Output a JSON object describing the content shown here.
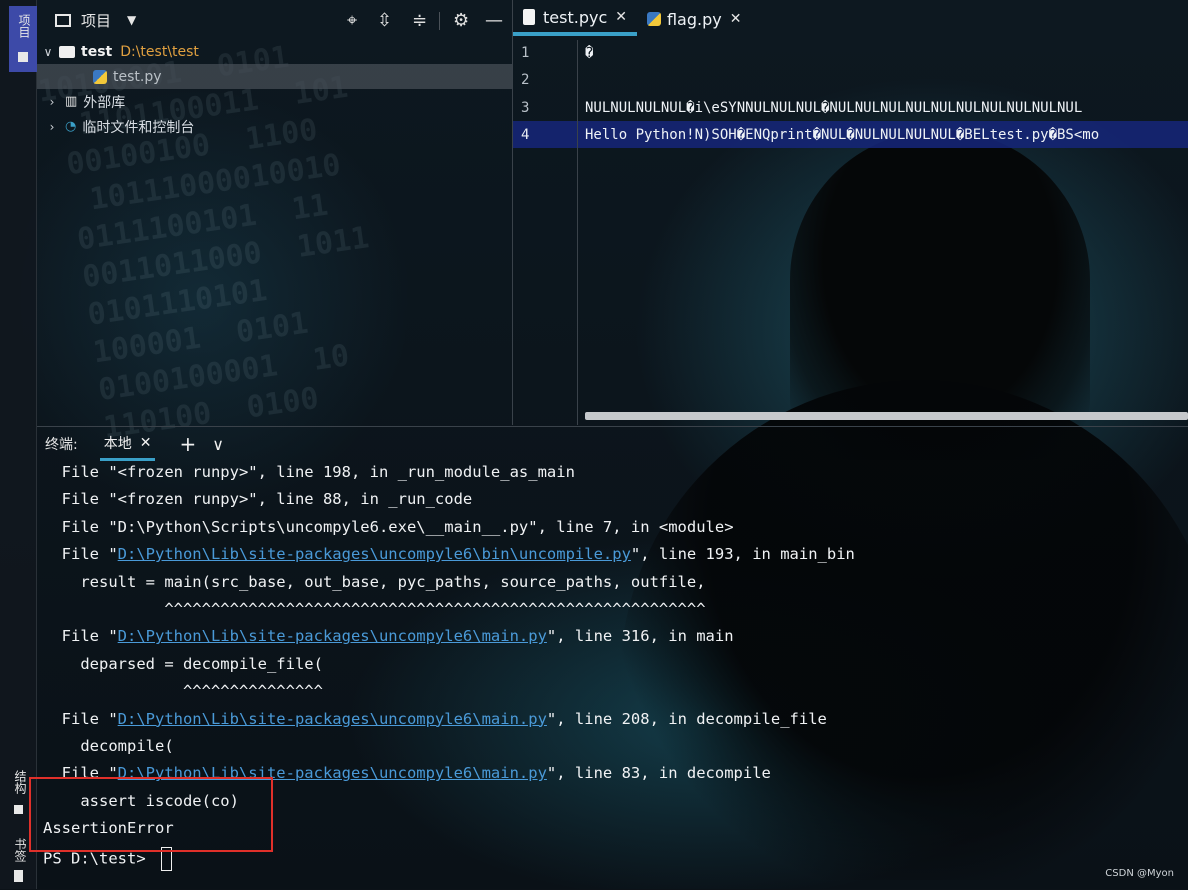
{
  "sidebar": {
    "project_tab": "项目",
    "structure_tab": "结构",
    "bookmarks_tab": "书签"
  },
  "project": {
    "title": "项目",
    "tree": [
      {
        "label": "test",
        "path": "D:\\test\\test"
      },
      {
        "label": "test.py"
      },
      {
        "label": "外部库"
      },
      {
        "label": "临时文件和控制台"
      }
    ]
  },
  "editor": {
    "tabs": [
      {
        "label": "test.pyc",
        "active": true
      },
      {
        "label": "flag.py",
        "active": false
      }
    ],
    "line_numbers": [
      "1",
      "2",
      "3",
      "4"
    ],
    "lines": [
      "�",
      "",
      "NULNULNULNUL�i\\eSYNNULNULNUL�NULNULNULNULNULNULNULNULNULNUL",
      "Hello Python!N)SOH�ENQprint�NUL�NULNULNULNUL�BELtest.py�BS<mo"
    ]
  },
  "terminal": {
    "label": "终端:",
    "tab": "本地",
    "lines": [
      {
        "pre": "  File \"<frozen runpy>\", line 198, in _run_module_as_main"
      },
      {
        "pre": "  File \"<frozen runpy>\", line 88, in _run_code"
      },
      {
        "pre": "  File \"D:\\Python\\Scripts\\uncompyle6.exe\\__main__.py\", line 7, in <module>"
      },
      {
        "pre": "  File \"",
        "link": "D:\\Python\\Lib\\site-packages\\uncompyle6\\bin\\uncompile.py",
        "post": "\", line 193, in main_bin"
      },
      {
        "pre": "    result = main(src_base, out_base, pyc_paths, source_paths, outfile,"
      },
      {
        "pre": "             ^^^^^^^^^^^^^^^^^^^^^^^^^^^^^^^^^^^^^^^^^^^^^^^^^^^^^^^^^^"
      },
      {
        "pre": "  File \"",
        "link": "D:\\Python\\Lib\\site-packages\\uncompyle6\\main.py",
        "post": "\", line 316, in main"
      },
      {
        "pre": "    deparsed = decompile_file("
      },
      {
        "pre": "               ^^^^^^^^^^^^^^^"
      },
      {
        "pre": "  File \"",
        "link": "D:\\Python\\Lib\\site-packages\\uncompyle6\\main.py",
        "post": "\", line 208, in decompile_file"
      },
      {
        "pre": "    decompile("
      },
      {
        "pre": "  File \"",
        "link": "D:\\Python\\Lib\\site-packages\\uncompyle6\\main.py",
        "post": "\", line 83, in decompile"
      },
      {
        "pre": "    assert iscode(co)"
      },
      {
        "pre": "AssertionError"
      },
      {
        "pre": "PS D:\\test> "
      }
    ]
  },
  "watermark": "CSDN @Myon⁠"
}
